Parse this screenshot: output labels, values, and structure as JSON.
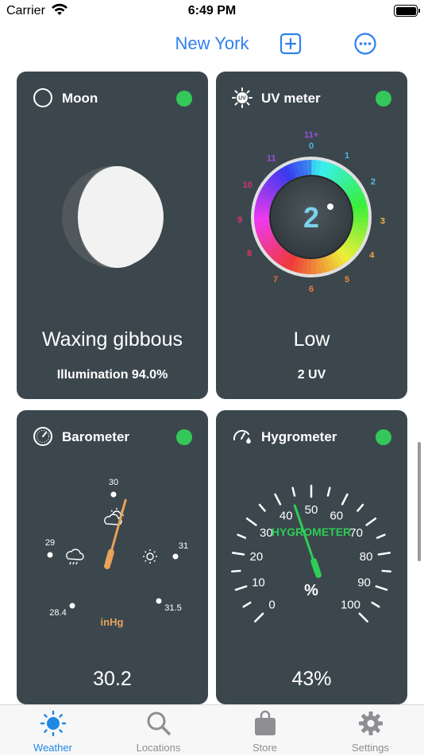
{
  "status_bar": {
    "carrier": "Carrier",
    "time": "6:49 PM"
  },
  "nav": {
    "title": "New York"
  },
  "moon": {
    "title": "Moon",
    "phase": "Waxing gibbous",
    "illumination": "Illumination 94.0%",
    "illumination_value": 94.0
  },
  "uv": {
    "title": "UV meter",
    "value": "2",
    "level": "Low",
    "reading": "2 UV",
    "scale_labels": [
      "0",
      "1",
      "2",
      "3",
      "4",
      "5",
      "6",
      "7",
      "8",
      "9",
      "10",
      "11",
      "11+"
    ],
    "icon_label": "UV"
  },
  "barometer": {
    "title": "Barometer",
    "reading": "30.2",
    "unit": "inHg",
    "value": 30.2,
    "scale_labels": [
      "28.4",
      "29",
      "30",
      "31",
      "31.5"
    ]
  },
  "hygrometer": {
    "title": "Hygrometer",
    "reading": "43%",
    "dial_title": "HYGROMETER",
    "unit": "%",
    "value": 43,
    "scale_labels": [
      "0",
      "10",
      "20",
      "30",
      "40",
      "50",
      "60",
      "70",
      "80",
      "90",
      "100"
    ]
  },
  "tabs": [
    {
      "label": "Weather",
      "icon": "sun-icon",
      "active": true
    },
    {
      "label": "Locations",
      "icon": "magnifier-icon",
      "active": false
    },
    {
      "label": "Store",
      "icon": "bag-icon",
      "active": false
    },
    {
      "label": "Settings",
      "icon": "gear-icon",
      "active": false
    }
  ],
  "colors": {
    "accent": "#2f80ed",
    "card_bg": "#3b474d",
    "status_green": "#34c759",
    "hygro_green": "#34c759",
    "baro_needle": "#e8a25a"
  }
}
